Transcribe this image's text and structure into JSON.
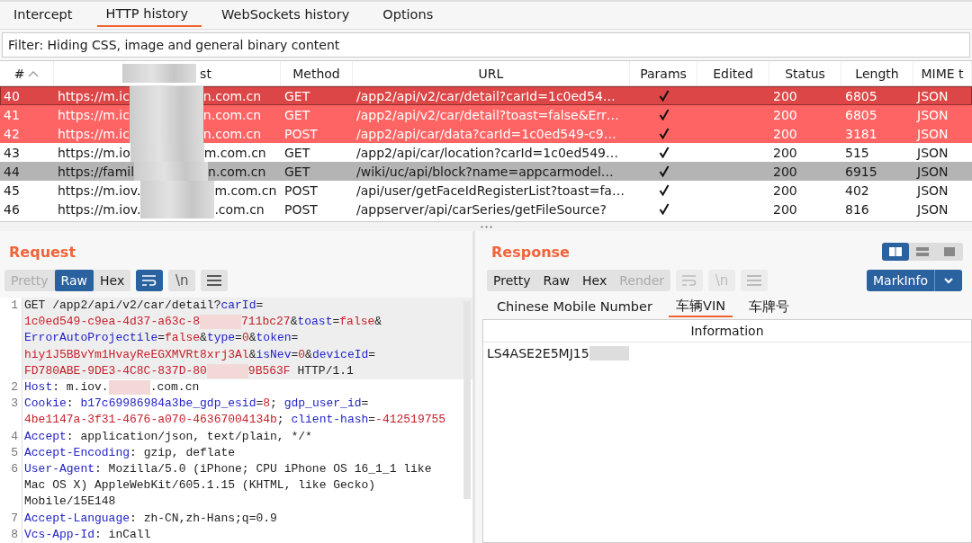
{
  "tabs": [
    {
      "label": "Intercept",
      "selected": false
    },
    {
      "label": "HTTP history",
      "selected": true
    },
    {
      "label": "WebSockets history",
      "selected": false
    },
    {
      "label": "Options",
      "selected": false
    }
  ],
  "filter": "Filter: Hiding CSS, image and general binary content",
  "table": {
    "columns": [
      {
        "label": "#",
        "sorted": true,
        "covered": false
      },
      {
        "label": "st",
        "sorted": false,
        "covered": true
      },
      {
        "label": "Method",
        "sorted": false,
        "covered": false
      },
      {
        "label": "URL",
        "sorted": false,
        "covered": false
      },
      {
        "label": "Params",
        "sorted": false,
        "covered": false
      },
      {
        "label": "Edited",
        "sorted": false,
        "covered": false
      },
      {
        "label": "Status",
        "sorted": false,
        "covered": false
      },
      {
        "label": "Length",
        "sorted": false,
        "covered": false
      },
      {
        "label": "MIME t",
        "sorted": false,
        "covered": false
      }
    ],
    "rows": [
      {
        "num": "40",
        "host_start": "https://m.ic",
        "host_end": "n.com.cn",
        "method": "GET",
        "url": "/app2/api/v2/car/detail?carId=1c0ed54…",
        "params": true,
        "status": "200",
        "length": "6805",
        "mime": "JSON",
        "selected": true,
        "color": "#dc4646"
      },
      {
        "num": "41",
        "host_start": "https://m.ic",
        "host_end": "n.com.cn",
        "method": "GET",
        "url": "/app2/api/v2/car/detail?toast=false&Err…",
        "params": true,
        "status": "200",
        "length": "6805",
        "mime": "JSON",
        "selected": false,
        "color": "#ff6464"
      },
      {
        "num": "42",
        "host_start": "https://m.ic",
        "host_end": "n.com.cn",
        "method": "POST",
        "url": "/app2/api/car/data?carId=1c0ed549-c9…",
        "params": true,
        "status": "200",
        "length": "3181",
        "mime": "JSON",
        "selected": false,
        "color": "#ff6464"
      },
      {
        "num": "43",
        "host_start": "https://m.io",
        "host_end": "m.com.cn",
        "method": "GET",
        "url": "/app2/api/car/location?carId=1c0ed549…",
        "params": true,
        "status": "200",
        "length": "515",
        "mime": "JSON",
        "selected": false,
        "color": "#ffffff"
      },
      {
        "num": "44",
        "host_start": "https://famil",
        "host_end": "n.com.cn",
        "method": "GET",
        "url": "/wiki/uc/api/block?name=appcarmodel…",
        "params": true,
        "status": "200",
        "length": "6915",
        "mime": "JSON",
        "selected": false,
        "color": "#b4b4b4"
      },
      {
        "num": "45",
        "host_start": "https://m.iov.",
        "host_end": "m.com.cn",
        "method": "POST",
        "url": "/api/user/getFaceIdRegisterList?toast=fa…",
        "params": true,
        "status": "200",
        "length": "402",
        "mime": "JSON",
        "selected": false,
        "color": "#ffffff"
      },
      {
        "num": "46",
        "host_start": "https://m.iov.",
        "host_end": ".com.cn",
        "method": "POST",
        "url": "/appserver/api/carSeries/getFileSource?",
        "params": true,
        "status": "200",
        "length": "816",
        "mime": "JSON",
        "selected": false,
        "color": "#ffffff"
      }
    ]
  },
  "request": {
    "title": "Request",
    "views": [
      {
        "label": "Pretty",
        "selected": false,
        "disabled": true
      },
      {
        "label": "Raw",
        "selected": true,
        "disabled": false
      },
      {
        "label": "Hex",
        "selected": false,
        "disabled": false
      }
    ],
    "tools": [
      {
        "kind": "wrap",
        "on": true
      },
      {
        "kind": "newline",
        "label": "\\n",
        "on": false
      },
      {
        "kind": "menu",
        "on": false
      }
    ],
    "lines": [
      {
        "number": "1",
        "rows": [
          {
            "tokens": [
              {
                "kind": "plain",
                "text": "GET /app2/api/v2/car/detail?"
              },
              {
                "kind": "key",
                "text": "carId"
              },
              {
                "kind": "plain",
                "text": "="
              }
            ]
          },
          {
            "tokens": [
              {
                "kind": "value",
                "text": "1c0ed549-c9ea-4d37-a63c-8"
              },
              {
                "kind": "redacted"
              },
              {
                "kind": "value",
                "text": "711bc27"
              },
              {
                "kind": "plain",
                "text": "&"
              },
              {
                "kind": "key",
                "text": "toast"
              },
              {
                "kind": "plain",
                "text": "="
              },
              {
                "kind": "value",
                "text": "false"
              },
              {
                "kind": "plain",
                "text": "&"
              }
            ]
          },
          {
            "tokens": [
              {
                "kind": "key",
                "text": "ErrorAutoProjectile"
              },
              {
                "kind": "plain",
                "text": "="
              },
              {
                "kind": "value",
                "text": "false"
              },
              {
                "kind": "plain",
                "text": "&"
              },
              {
                "kind": "key",
                "text": "type"
              },
              {
                "kind": "plain",
                "text": "="
              },
              {
                "kind": "value",
                "text": "0"
              },
              {
                "kind": "plain",
                "text": "&"
              },
              {
                "kind": "key",
                "text": "token"
              },
              {
                "kind": "plain",
                "text": "="
              }
            ]
          },
          {
            "tokens": [
              {
                "kind": "value",
                "text": "hiy1J5BBvYm1HvayReEGXMVRt8xrj3Al"
              },
              {
                "kind": "plain",
                "text": "&"
              },
              {
                "kind": "key",
                "text": "isNev"
              },
              {
                "kind": "plain",
                "text": "="
              },
              {
                "kind": "value",
                "text": "0"
              },
              {
                "kind": "plain",
                "text": "&"
              },
              {
                "kind": "key",
                "text": "deviceId"
              },
              {
                "kind": "plain",
                "text": "="
              }
            ]
          },
          {
            "tokens": [
              {
                "kind": "value",
                "text": "FD780ABE-9DE3-4C8C-837D-80"
              },
              {
                "kind": "redacted"
              },
              {
                "kind": "value",
                "text": "9B563F"
              },
              {
                "kind": "plain",
                "text": " HTTP/1.1"
              }
            ]
          }
        ]
      },
      {
        "number": "2",
        "rows": [
          {
            "tokens": [
              {
                "kind": "key",
                "text": "Host"
              },
              {
                "kind": "plain",
                "text": ": m.iov."
              },
              {
                "kind": "redacted"
              },
              {
                "kind": "plain",
                "text": ".com.cn"
              }
            ]
          }
        ]
      },
      {
        "number": "3",
        "rows": [
          {
            "tokens": [
              {
                "kind": "key",
                "text": "Cookie"
              },
              {
                "kind": "plain",
                "text": ": "
              },
              {
                "kind": "key",
                "text": "b17c69986984a3be_gdp_esid"
              },
              {
                "kind": "plain",
                "text": "="
              },
              {
                "kind": "value",
                "text": "8"
              },
              {
                "kind": "plain",
                "text": "; "
              },
              {
                "kind": "key",
                "text": "gdp_user_id"
              },
              {
                "kind": "plain",
                "text": "="
              }
            ]
          },
          {
            "tokens": [
              {
                "kind": "value",
                "text": "4be1147a-3f31-4676-a070-46367004134b"
              },
              {
                "kind": "plain",
                "text": "; "
              },
              {
                "kind": "key",
                "text": "client-hash"
              },
              {
                "kind": "plain",
                "text": "="
              },
              {
                "kind": "value",
                "text": "-412519755"
              }
            ]
          }
        ]
      },
      {
        "number": "4",
        "rows": [
          {
            "tokens": [
              {
                "kind": "key",
                "text": "Accept"
              },
              {
                "kind": "plain",
                "text": ": application/json, text/plain, */*"
              }
            ]
          }
        ]
      },
      {
        "number": "5",
        "rows": [
          {
            "tokens": [
              {
                "kind": "key",
                "text": "Accept-Encoding"
              },
              {
                "kind": "plain",
                "text": ": gzip, deflate"
              }
            ]
          }
        ]
      },
      {
        "number": "6",
        "rows": [
          {
            "tokens": [
              {
                "kind": "key",
                "text": "User-Agent"
              },
              {
                "kind": "plain",
                "text": ": Mozilla/5.0 (iPhone; CPU iPhone OS 16_1_1 like"
              }
            ]
          },
          {
            "tokens": [
              {
                "kind": "plain",
                "text": "Mac OS X) AppleWebKit/605.1.15 (KHTML, like Gecko)"
              }
            ]
          },
          {
            "tokens": [
              {
                "kind": "plain",
                "text": "Mobile/15E148"
              }
            ]
          }
        ]
      },
      {
        "number": "7",
        "rows": [
          {
            "tokens": [
              {
                "kind": "key",
                "text": "Accept-Language"
              },
              {
                "kind": "plain",
                "text": ": zh-CN,zh-Hans;q=0.9"
              }
            ]
          }
        ]
      },
      {
        "number": "8",
        "rows": [
          {
            "tokens": [
              {
                "kind": "key",
                "text": "Vcs-App-Id"
              },
              {
                "kind": "plain",
                "text": ": inCall"
              }
            ]
          }
        ]
      }
    ]
  },
  "response": {
    "title": "Response",
    "layouts": [
      {
        "selected": true,
        "kind": "columns"
      },
      {
        "selected": false,
        "kind": "rows"
      },
      {
        "selected": false,
        "kind": "single"
      }
    ],
    "views": [
      {
        "label": "Pretty",
        "selected": false,
        "disabled": false
      },
      {
        "label": "Raw",
        "selected": false,
        "disabled": false
      },
      {
        "label": "Hex",
        "selected": false,
        "disabled": false
      },
      {
        "label": "Render",
        "selected": false,
        "disabled": true
      }
    ],
    "tools": [
      {
        "kind": "wrap",
        "disabled": true
      },
      {
        "kind": "newline",
        "label": "\\n",
        "disabled": true
      },
      {
        "kind": "menu",
        "disabled": true
      }
    ],
    "markinfo": "MarkInfo",
    "info_tabs": [
      {
        "label": "Chinese Mobile Number",
        "selected": false
      },
      {
        "label": "车辆VIN",
        "selected": true
      },
      {
        "label": "车牌号",
        "selected": false
      }
    ],
    "info_header": "Information",
    "info_rows": [
      {
        "text": "LS4ASE2E5MJ15",
        "redacted": true
      }
    ]
  }
}
